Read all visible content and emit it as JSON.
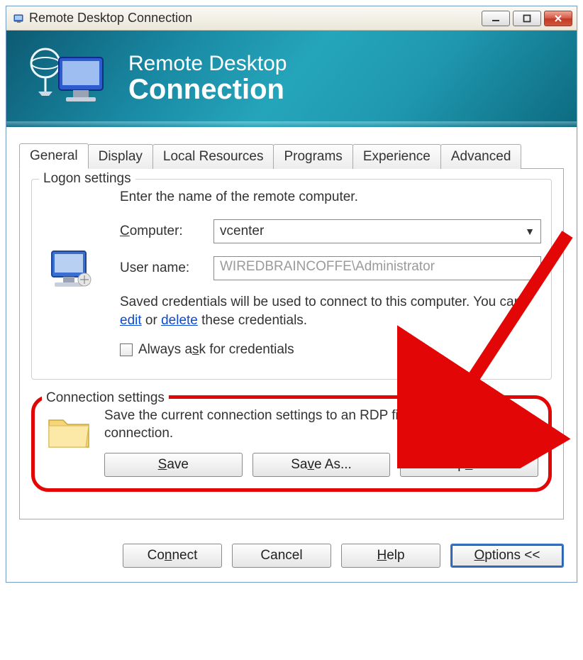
{
  "window": {
    "title": "Remote Desktop Connection"
  },
  "banner": {
    "line1": "Remote Desktop",
    "line2": "Connection"
  },
  "tabs": {
    "items": [
      {
        "label": "General"
      },
      {
        "label": "Display"
      },
      {
        "label": "Local Resources"
      },
      {
        "label": "Programs"
      },
      {
        "label": "Experience"
      },
      {
        "label": "Advanced"
      }
    ],
    "active_index": 0
  },
  "logon": {
    "group_title": "Logon settings",
    "instruction": "Enter the name of the remote computer.",
    "computer_label": "Computer:",
    "computer_value": "vcenter",
    "username_label": "User name:",
    "username_value": "WIREDBRAINCOFFE\\Administrator",
    "saved_text_prefix": "Saved credentials will be used to connect to this computer. You can ",
    "edit_link": "edit",
    "or_text": " or ",
    "delete_link": "delete",
    "saved_text_suffix": " these credentials.",
    "always_ask_label": "Always ask for credentials",
    "always_ask_checked": false
  },
  "connection": {
    "group_title": "Connection settings",
    "text": "Save the current connection settings to an RDP file or open a saved connection.",
    "save_label": "Save",
    "save_as_label": "Save As...",
    "open_label": "Open..."
  },
  "footer": {
    "connect_label": "Connect",
    "cancel_label": "Cancel",
    "help_label": "Help",
    "options_label": "Options <<"
  }
}
